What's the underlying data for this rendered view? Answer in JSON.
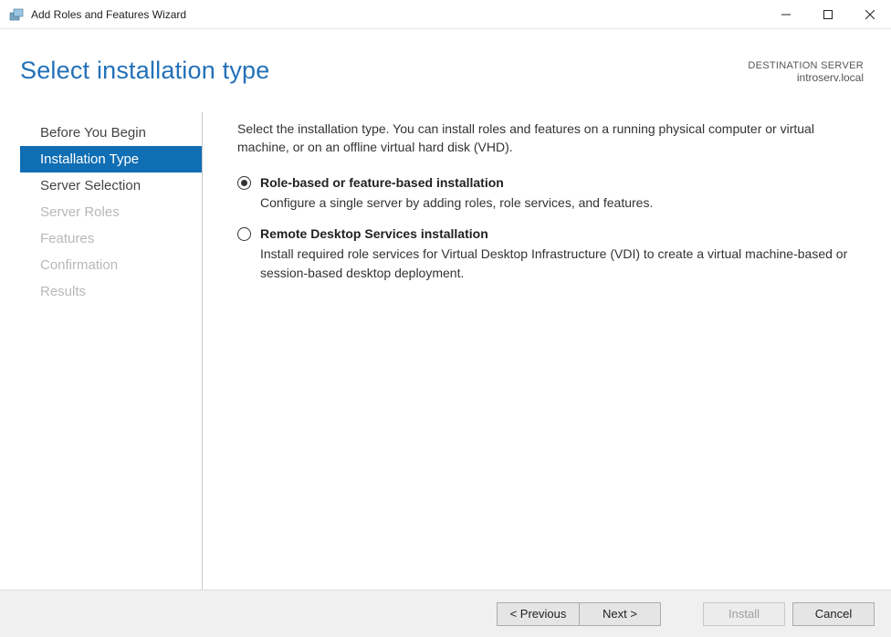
{
  "window": {
    "title": "Add Roles and Features Wizard"
  },
  "header": {
    "page_title": "Select installation type",
    "dest_label": "DESTINATION SERVER",
    "dest_server": "introserv.local"
  },
  "sidebar": {
    "steps": {
      "0": {
        "label": "Before You Begin"
      },
      "1": {
        "label": "Installation Type"
      },
      "2": {
        "label": "Server Selection"
      },
      "3": {
        "label": "Server Roles"
      },
      "4": {
        "label": "Features"
      },
      "5": {
        "label": "Confirmation"
      },
      "6": {
        "label": "Results"
      }
    }
  },
  "content": {
    "intro": "Select the installation type. You can install roles and features on a running physical computer or virtual machine, or on an offline virtual hard disk (VHD).",
    "options": {
      "0": {
        "title": "Role-based or feature-based installation",
        "desc": "Configure a single server by adding roles, role services, and features."
      },
      "1": {
        "title": "Remote Desktop Services installation",
        "desc": "Install required role services for Virtual Desktop Infrastructure (VDI) to create a virtual machine-based or session-based desktop deployment."
      }
    }
  },
  "footer": {
    "previous": "< Previous",
    "next": "Next >",
    "install": "Install",
    "cancel": "Cancel"
  }
}
